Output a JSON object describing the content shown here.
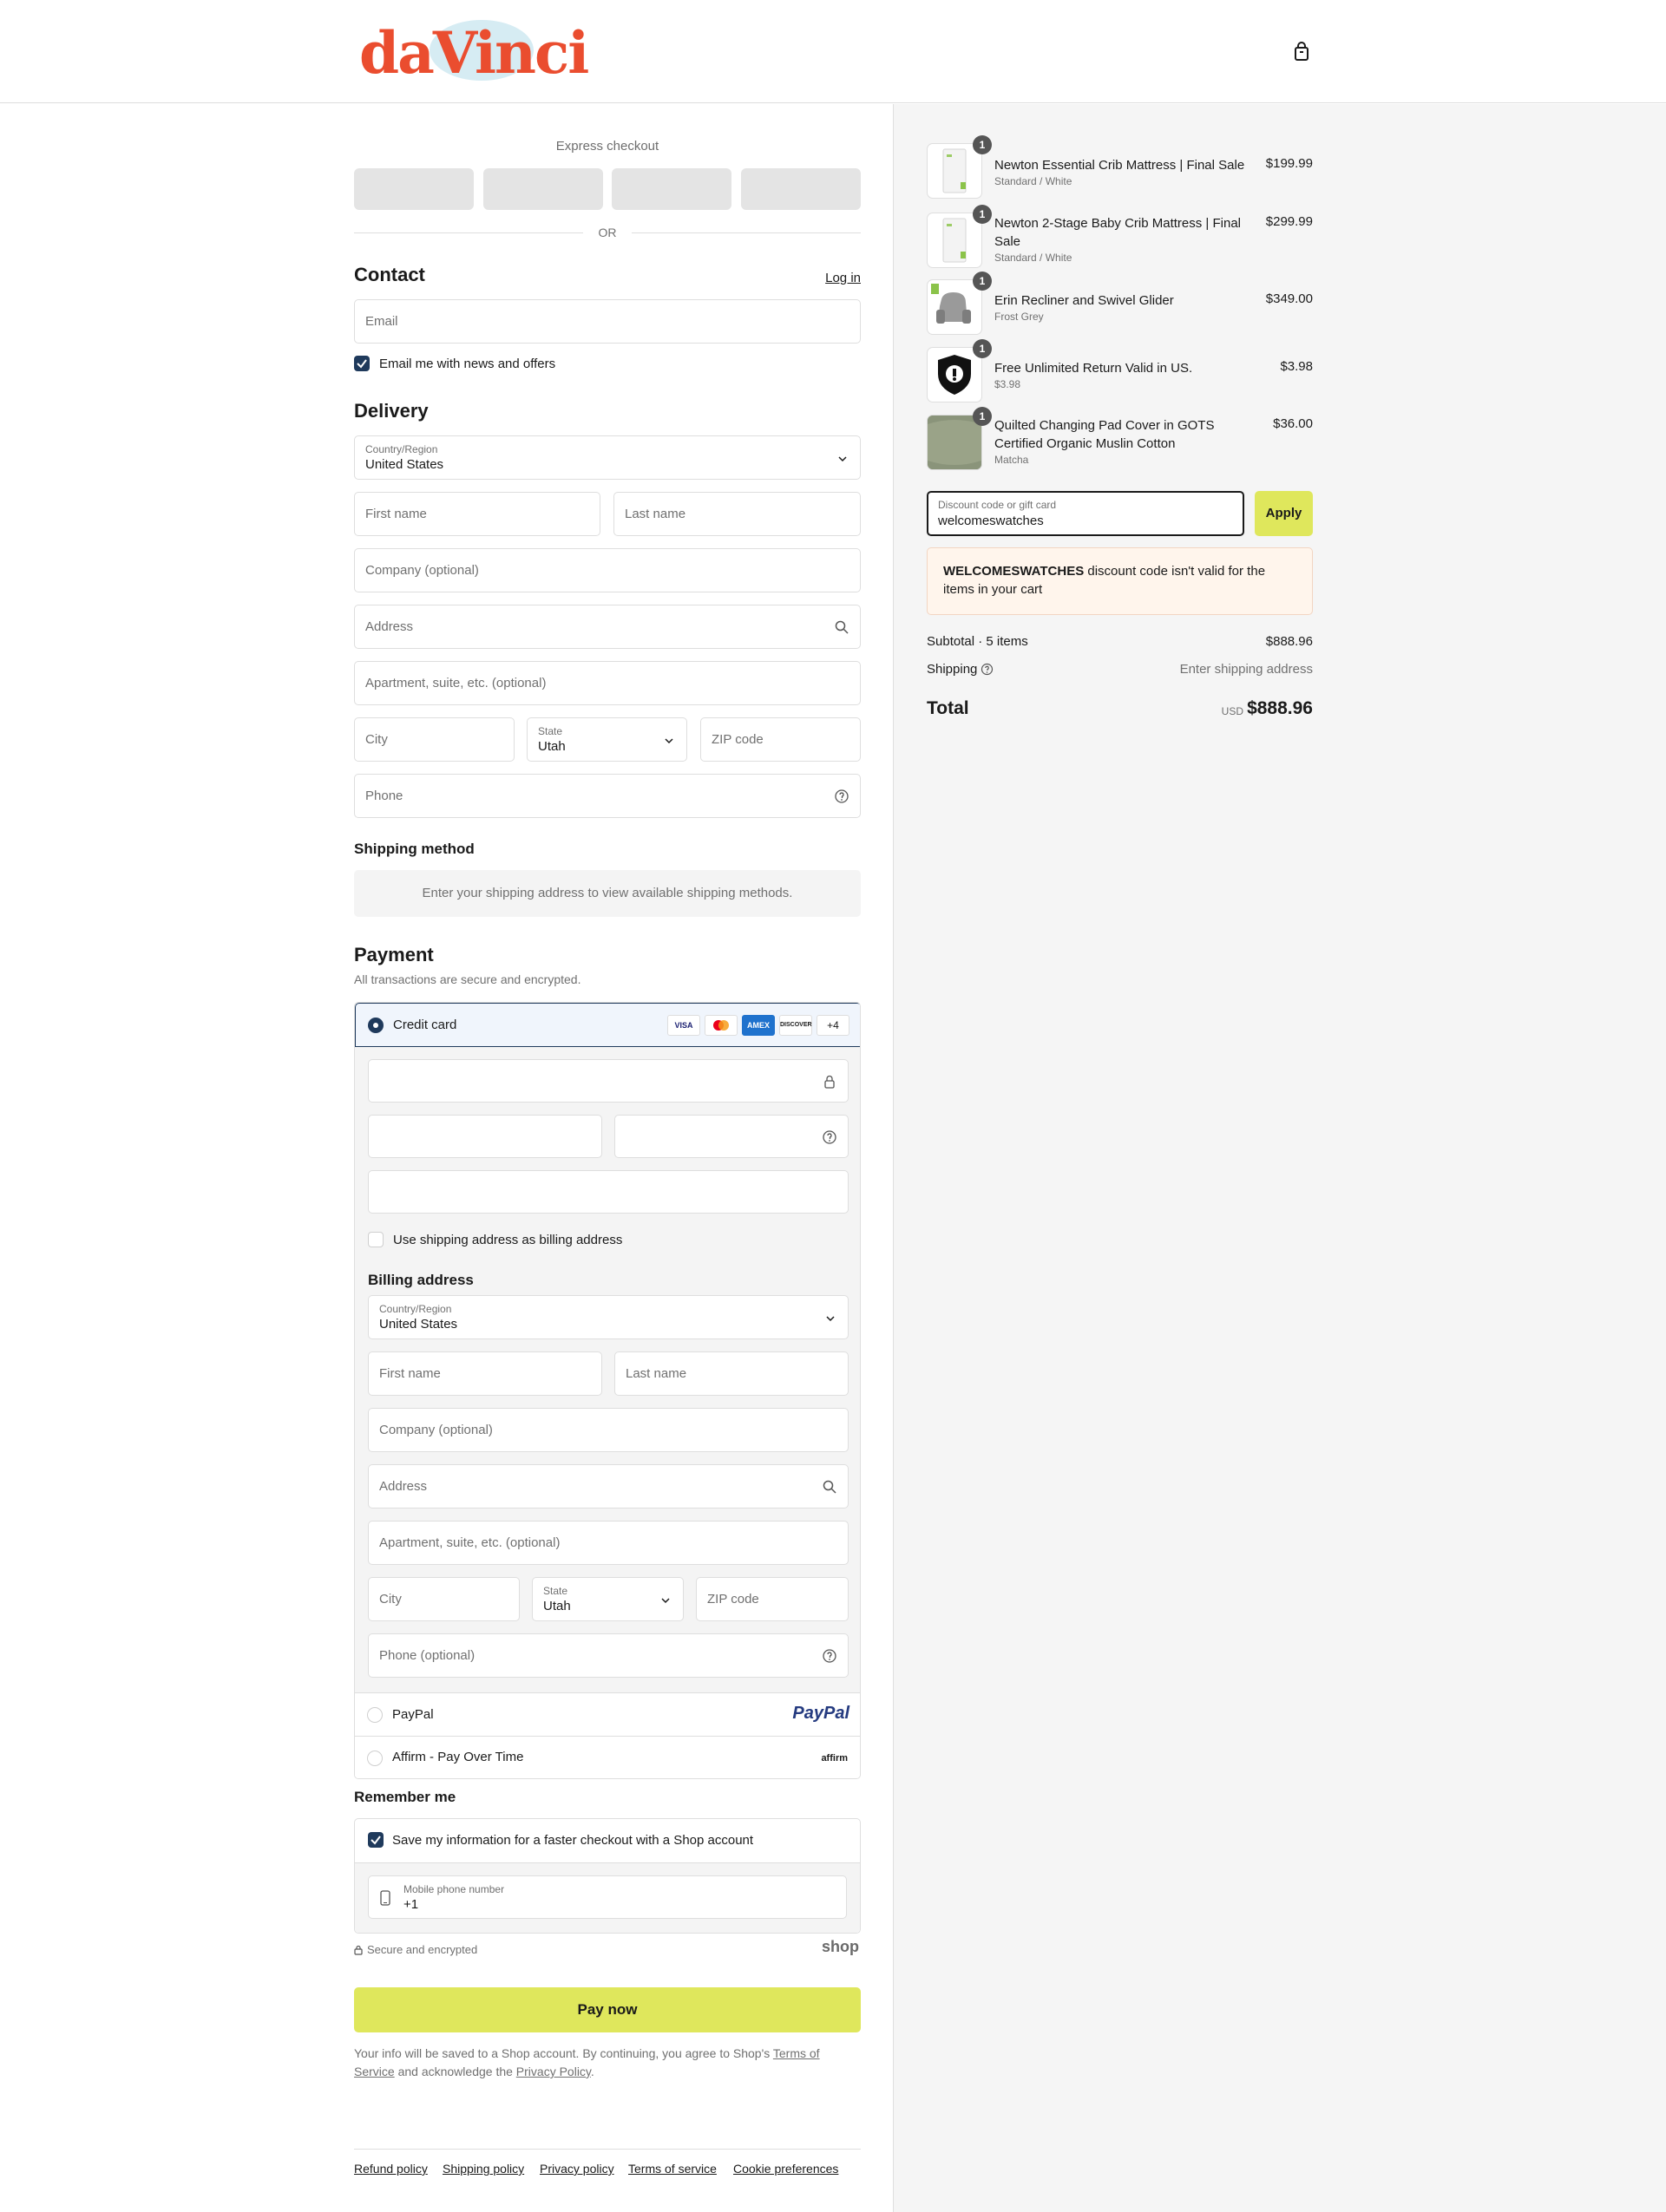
{
  "header": {
    "brand": "daVinci",
    "cart_icon": "bag-icon"
  },
  "express": {
    "label": "Express checkout",
    "or": "OR"
  },
  "contact": {
    "title": "Contact",
    "login": "Log in",
    "email_placeholder": "Email",
    "newsletter_label": "Email me with news and offers",
    "newsletter_checked": true
  },
  "delivery": {
    "title": "Delivery",
    "country_label": "Country/Region",
    "country_value": "United States",
    "first_name": "First name",
    "last_name": "Last name",
    "company": "Company (optional)",
    "address": "Address",
    "apartment": "Apartment, suite, etc. (optional)",
    "city": "City",
    "state_label": "State",
    "state_value": "Utah",
    "zip": "ZIP code",
    "phone": "Phone"
  },
  "shipping_method": {
    "title": "Shipping method",
    "note": "Enter your shipping address to view available shipping methods."
  },
  "payment": {
    "title": "Payment",
    "subtitle": "All transactions are secure and encrypted.",
    "credit_card_label": "Credit card",
    "card_brands": [
      "VISA",
      "MC",
      "AMEX",
      "DISCOVER"
    ],
    "more_brands": "+4",
    "use_shipping_label": "Use shipping address as billing address",
    "billing_title": "Billing address",
    "billing": {
      "country_label": "Country/Region",
      "country_value": "United States",
      "first_name": "First name",
      "last_name": "Last name",
      "company": "Company (optional)",
      "address": "Address",
      "apartment": "Apartment, suite, etc. (optional)",
      "city": "City",
      "state_label": "State",
      "state_value": "Utah",
      "zip": "ZIP code",
      "phone": "Phone (optional)"
    },
    "paypal_label": "PayPal",
    "paypal_logo": "PayPal",
    "affirm_label": "Affirm - Pay Over Time",
    "affirm_logo": "affirm"
  },
  "remember": {
    "title": "Remember me",
    "save_label": "Save my information for a faster checkout with a Shop account",
    "save_checked": true,
    "mobile_label": "Mobile phone number",
    "mobile_value": "+1",
    "secure_label": "Secure and encrypted",
    "shop_logo": "shop"
  },
  "pay_now": "Pay now",
  "legal": {
    "prefix": "Your info will be saved to a Shop account. By continuing, you agree to Shop's ",
    "terms": "Terms of Service",
    "middle": " and acknowledge the ",
    "privacy": "Privacy Policy",
    "suffix": "."
  },
  "footer": [
    "Refund policy",
    "Shipping policy",
    "Privacy policy",
    "Terms of service",
    "Cookie preferences"
  ],
  "order": {
    "items": [
      {
        "name": "Newton Essential Crib Mattress | Final Sale",
        "variant": "Standard / White",
        "price": "$199.99",
        "qty": "1"
      },
      {
        "name": "Newton 2-Stage Baby Crib Mattress | Final Sale",
        "variant": "Standard / White",
        "price": "$299.99",
        "qty": "1"
      },
      {
        "name": "Erin Recliner and Swivel Glider",
        "variant": "Frost Grey",
        "price": "$349.00",
        "qty": "1"
      },
      {
        "name": "Free Unlimited Return Valid in US.",
        "variant": "$3.98",
        "price": "$3.98",
        "qty": "1"
      },
      {
        "name": "Quilted Changing Pad Cover in GOTS Certified Organic Muslin Cotton",
        "variant": "Matcha",
        "price": "$36.00",
        "qty": "1"
      }
    ],
    "discount_label": "Discount code or gift card",
    "discount_value": "welcomeswatches",
    "apply": "Apply",
    "error_code": "WELCOMESWATCHES",
    "error_text": " discount code isn't valid for the items in your cart",
    "subtotal_label": "Subtotal · 5 items",
    "subtotal_value": "$888.96",
    "shipping_label": "Shipping",
    "shipping_value": "Enter shipping address",
    "total_label": "Total",
    "currency": "USD",
    "total_value": "$888.96"
  },
  "colors": {
    "accent": "#dfe75c",
    "brand": "#ea4d2f",
    "selected": "#1f3a5c"
  }
}
